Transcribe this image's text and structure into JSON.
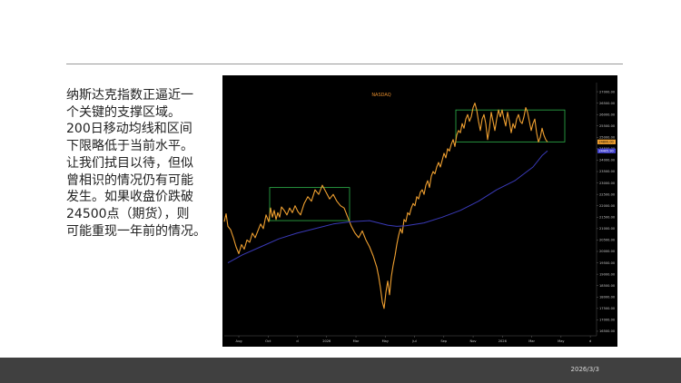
{
  "slide": {
    "caption": "纳斯达克指数正逼近一\n个关键的支撑区域。\n200日移动均线和区间\n下限略低于当前水平。\n让我们拭目以待，但似\n曾相识的情况仍有可能\n发生。如果收盘价跌破\n24500点（期货），则\n可能重现一年前的情况。",
    "footer_date": "2026/3/3"
  },
  "colors": {
    "price_line": "#f0a030",
    "ma_line": "#3a3ab8",
    "box_outline": "#2fb44a",
    "background": "#000000",
    "price_tag_orange": "#f0a030",
    "price_tag_blue": "#4040d0"
  },
  "chart_data": {
    "type": "line",
    "title": "NASDAQ",
    "x_tick_labels": [
      "Aug",
      "Oct",
      "d",
      "2026",
      "Mar",
      "May",
      "Jul",
      "Sep",
      "Nov",
      "2026",
      "Mar",
      "May",
      "d"
    ],
    "y_tick_labels": [
      "16500.00",
      "17000.00",
      "17500.00",
      "18000.00",
      "18500.00",
      "19000.00",
      "19500.00",
      "20000.00",
      "20500.00",
      "21000.00",
      "21500.00",
      "22000.00",
      "22500.00",
      "23000.00",
      "23500.00",
      "24000.00",
      "24500.00",
      "25000.00",
      "25500.00",
      "26000.00",
      "26500.00",
      "27000.00"
    ],
    "ylim": [
      16300,
      27400
    ],
    "price_tags": [
      {
        "label": "24800.00",
        "value": 24800,
        "color": "orange"
      },
      {
        "label": "24405.90",
        "value": 24405.9,
        "color": "blue"
      }
    ],
    "series": [
      {
        "name": "NASDAQ",
        "role": "price",
        "x": [
          0,
          2,
          4,
          7,
          10,
          13,
          16,
          19,
          22,
          25,
          28,
          31,
          34,
          37,
          40,
          43,
          46,
          49,
          51,
          53,
          55,
          57,
          59,
          61,
          63,
          66,
          69,
          72,
          75,
          78,
          81,
          84,
          88,
          92,
          96,
          100,
          104,
          108,
          112,
          116,
          120,
          124,
          128,
          132,
          136,
          140,
          144,
          148,
          152,
          156,
          160,
          164,
          168,
          170,
          172,
          174,
          176,
          178,
          180,
          182,
          184,
          186,
          188,
          190,
          192,
          194,
          196,
          198,
          200,
          202,
          204,
          206,
          208,
          210,
          212,
          214,
          216,
          218,
          220,
          222,
          224,
          226,
          228,
          230,
          232,
          234,
          236,
          238,
          240,
          242,
          244,
          246,
          248,
          250,
          252,
          254,
          256,
          258,
          260,
          262,
          264,
          266,
          268,
          270,
          272,
          274,
          276,
          278,
          280,
          282,
          284,
          286,
          288,
          290,
          292,
          294,
          296,
          298,
          300,
          302,
          304,
          306,
          308,
          310,
          312,
          314,
          316,
          318,
          320,
          322,
          324,
          326,
          328,
          330,
          332,
          334,
          336,
          338,
          340,
          342,
          344,
          346,
          348,
          350,
          352,
          354,
          356
        ],
        "values": [
          21300,
          21650,
          21100,
          20950,
          20600,
          20200,
          19900,
          20300,
          20100,
          20500,
          20400,
          20800,
          20600,
          20900,
          21200,
          21000,
          21600,
          21300,
          21900,
          21500,
          21800,
          21400,
          21700,
          21500,
          21950,
          21800,
          21600,
          21900,
          21700,
          22000,
          21750,
          21600,
          22100,
          22400,
          22200,
          22700,
          22500,
          22900,
          22600,
          22300,
          22500,
          22200,
          22000,
          21900,
          21500,
          21100,
          20800,
          20600,
          20900,
          20500,
          20200,
          19800,
          19300,
          18900,
          18400,
          17800,
          17500,
          18200,
          18700,
          18100,
          18900,
          19400,
          19800,
          20300,
          20700,
          21000,
          20800,
          21400,
          21300,
          21700,
          21600,
          21900,
          22100,
          22000,
          22400,
          22300,
          22600,
          22700,
          22500,
          22900,
          23100,
          22800,
          23300,
          23500,
          23400,
          23700,
          23900,
          23700,
          24000,
          24300,
          24100,
          24500,
          24400,
          24700,
          24900,
          24600,
          25100,
          25300,
          25200,
          25600,
          25400,
          25800,
          26000,
          25700,
          25900,
          26300,
          26500,
          26200,
          25700,
          25300,
          25800,
          26000,
          25600,
          24900,
          25400,
          26100,
          25700,
          25300,
          25800,
          26200,
          25900,
          26200,
          25800,
          25500,
          26100,
          25700,
          25200,
          25600,
          25400,
          25800,
          26000,
          25700,
          25600,
          25900,
          26300,
          26100,
          25700,
          25300,
          25600,
          25800,
          25200,
          24800,
          25000,
          25400,
          25100,
          24900,
          24800
        ]
      },
      {
        "name": "200 MA",
        "role": "moving-average",
        "x": [
          4,
          20,
          40,
          60,
          80,
          100,
          120,
          140,
          160,
          170,
          180,
          190,
          200,
          220,
          240,
          260,
          280,
          300,
          320,
          340,
          350,
          356
        ],
        "values": [
          19500,
          19850,
          20200,
          20550,
          20800,
          21000,
          21200,
          21300,
          21350,
          21250,
          21150,
          21100,
          21120,
          21250,
          21500,
          21800,
          22200,
          22700,
          23100,
          23700,
          24200,
          24405
        ]
      }
    ],
    "annotations": [
      {
        "type": "range-box",
        "x_start": 50,
        "x_end": 138,
        "y_low": 21350,
        "y_high": 22800
      },
      {
        "type": "range-box",
        "x_start": 255,
        "x_end": 375,
        "y_low": 24800,
        "y_high": 26200
      }
    ],
    "grid": false,
    "x_domain": [
      0,
      410
    ]
  }
}
